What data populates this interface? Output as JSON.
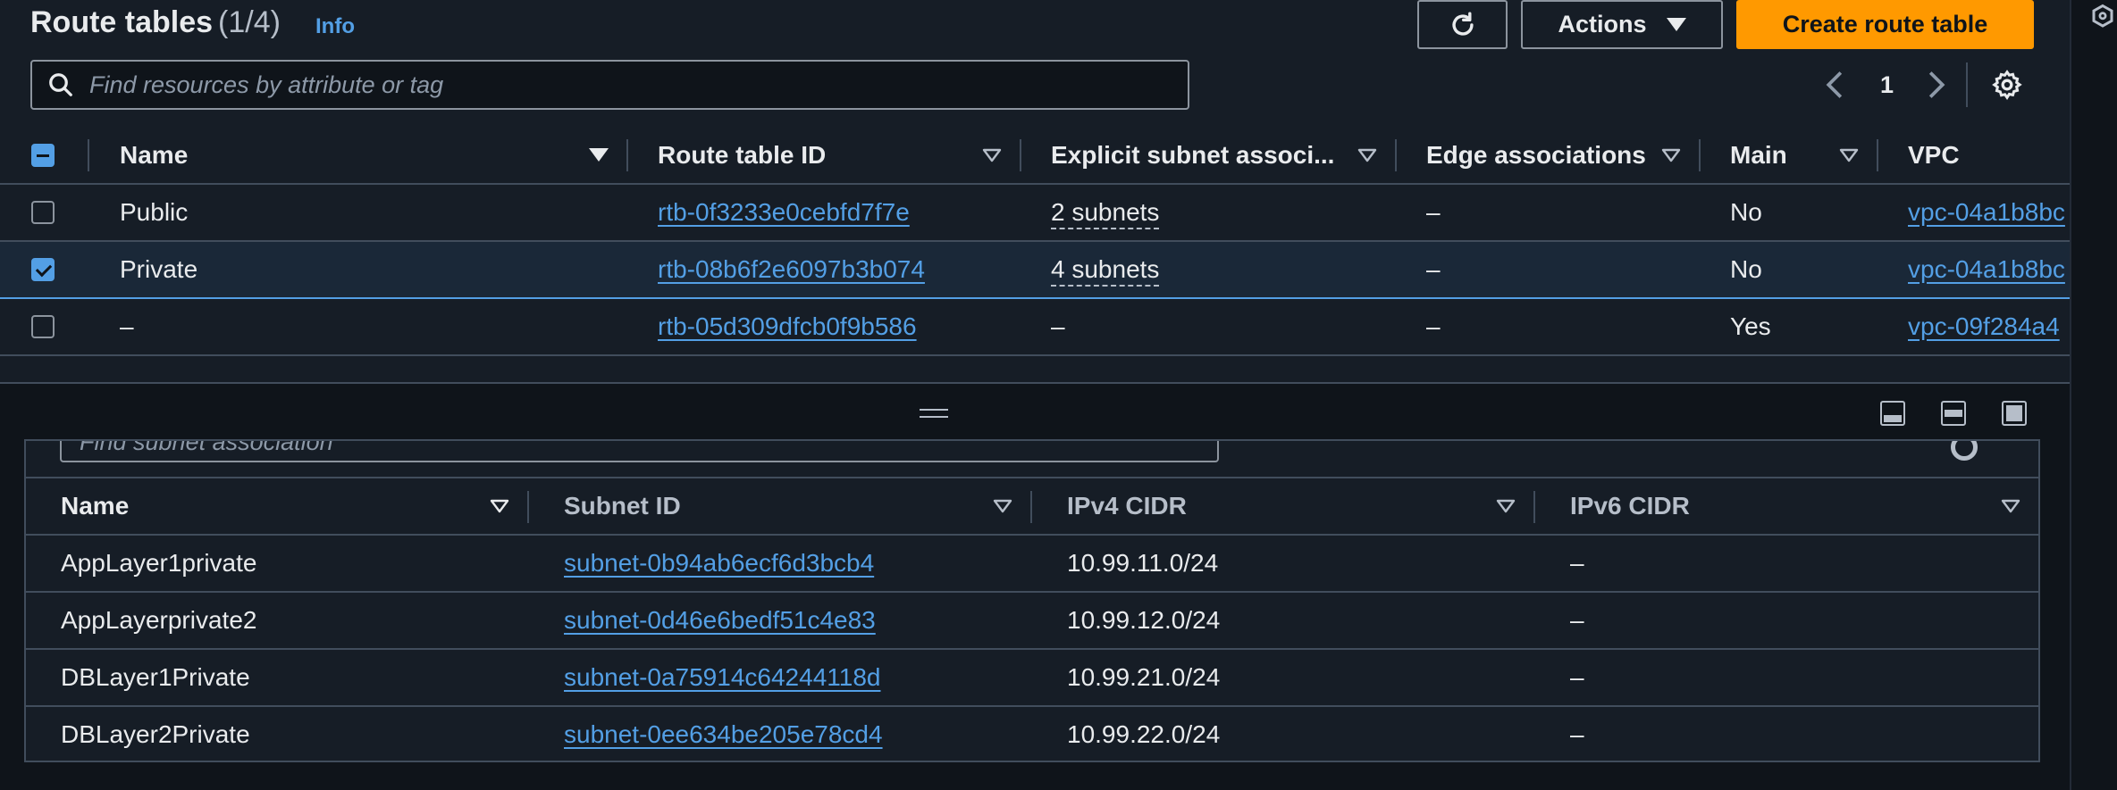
{
  "header": {
    "title": "Route tables",
    "count": "(1/4)",
    "info": "Info"
  },
  "toolbar": {
    "actions_label": "Actions",
    "create_label": "Create route table"
  },
  "search": {
    "placeholder": "Find resources by attribute or tag"
  },
  "pagination": {
    "page": "1"
  },
  "route_table": {
    "columns": [
      "Name",
      "Route table ID",
      "Explicit subnet associ...",
      "Edge associations",
      "Main",
      "VPC"
    ],
    "rows": [
      {
        "name": "Public",
        "id": "rtb-0f3233e0cebfd7f7e",
        "subnets": "2 subnets",
        "edge": "–",
        "main": "No",
        "vpc": "vpc-04a1b8bc",
        "selected": false
      },
      {
        "name": "Private",
        "id": "rtb-08b6f2e6097b3b074",
        "subnets": "4 subnets",
        "edge": "–",
        "main": "No",
        "vpc": "vpc-04a1b8bc",
        "selected": true
      },
      {
        "name": "–",
        "id": "rtb-05d309dfcb0f9b586",
        "subnets": "–",
        "edge": "–",
        "main": "Yes",
        "vpc": "vpc-09f284a4",
        "selected": false
      }
    ]
  },
  "subnet_panel": {
    "search_placeholder": "Find subnet association",
    "columns": [
      "Name",
      "Subnet ID",
      "IPv4 CIDR",
      "IPv6 CIDR"
    ],
    "rows": [
      {
        "name": "AppLayer1private",
        "subnet_id": "subnet-0b94ab6ecf6d3bcb4",
        "ipv4": "10.99.11.0/24",
        "ipv6": "–"
      },
      {
        "name": "AppLayerprivate2",
        "subnet_id": "subnet-0d46e6bedf51c4e83",
        "ipv4": "10.99.12.0/24",
        "ipv6": "–"
      },
      {
        "name": "DBLayer1Private",
        "subnet_id": "subnet-0a75914c64244118d",
        "ipv4": "10.99.21.0/24",
        "ipv6": "–"
      },
      {
        "name": "DBLayer2Private",
        "subnet_id": "subnet-0ee634be205e78cd4",
        "ipv4": "10.99.22.0/24",
        "ipv6": "–"
      }
    ]
  },
  "colors": {
    "accent": "#ff9900",
    "link": "#539fe5",
    "background": "#161d26"
  }
}
